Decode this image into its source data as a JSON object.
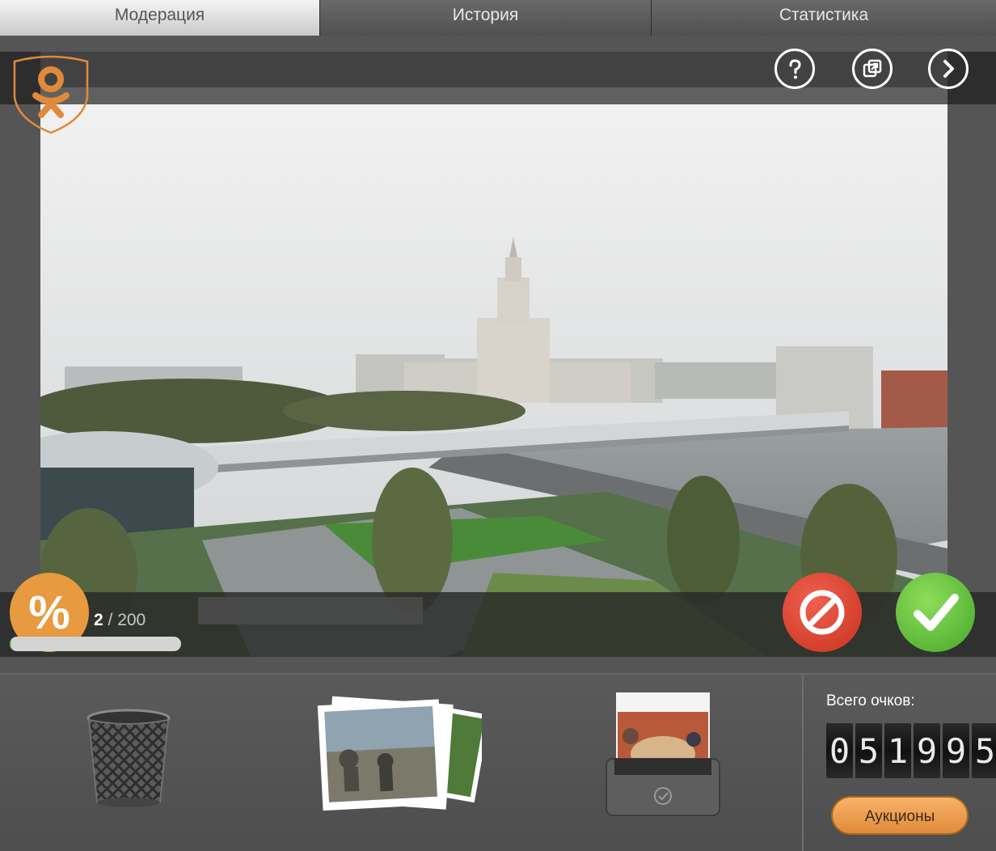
{
  "tabs": [
    {
      "label": "Модерация",
      "active": true
    },
    {
      "label": "История",
      "active": false
    },
    {
      "label": "Статистика",
      "active": false
    }
  ],
  "toolbar": {
    "help_icon": "question-circle-icon",
    "popout_icon": "external-window-icon",
    "next_icon": "chevron-right-icon"
  },
  "progress": {
    "current": "2",
    "separator": " / ",
    "total": "200",
    "fraction": 0.01,
    "percent_symbol": "%"
  },
  "actions": {
    "reject_icon": "prohibited-icon",
    "accept_icon": "checkmark-icon"
  },
  "footer": {
    "trash_icon": "trash-bin-icon",
    "photos_icon": "photo-stack-icon",
    "approved_icon": "approved-tray-icon"
  },
  "score": {
    "label": "Всего очков:",
    "digits": [
      "0",
      "5",
      "1",
      "9",
      "9",
      "5"
    ],
    "auction_button": "Аукционы"
  },
  "colors": {
    "accent_orange": "#e79a3f",
    "reject_red": "#d63a27",
    "accept_green": "#5cba35"
  }
}
